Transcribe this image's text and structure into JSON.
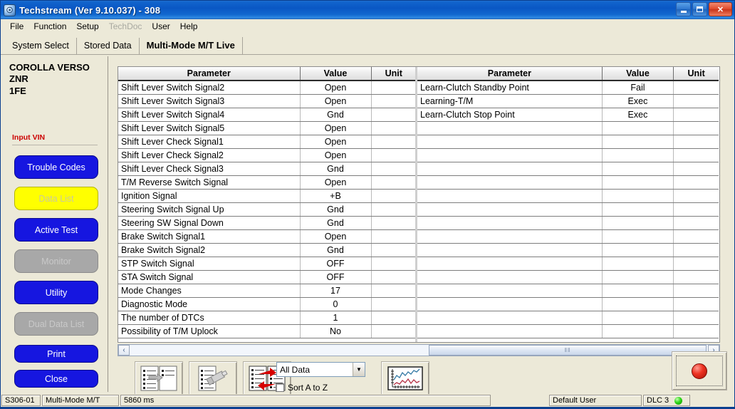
{
  "titlebar": {
    "title": "Techstream (Ver 9.10.037) - 308",
    "icon": "techstream-logo-icon",
    "minimize": "–",
    "maximize": "❐",
    "close": "✕"
  },
  "menubar": {
    "items": [
      {
        "label": "File",
        "disabled": false
      },
      {
        "label": "Function",
        "disabled": false
      },
      {
        "label": "Setup",
        "disabled": false
      },
      {
        "label": "TechDoc",
        "disabled": true
      },
      {
        "label": "User",
        "disabled": false
      },
      {
        "label": "Help",
        "disabled": false
      }
    ]
  },
  "tabs": [
    {
      "label": "System Select",
      "active": false
    },
    {
      "label": "Stored Data",
      "active": false
    },
    {
      "label": "Multi-Mode M/T Live",
      "active": true
    }
  ],
  "sidebar": {
    "vehicle": {
      "model": "COROLLA VERSO",
      "code": "ZNR",
      "engine": "1FE"
    },
    "vin_label": "Input VIN",
    "vin_label_color": "#cc0000",
    "buttons": [
      {
        "label": "Trouble Codes",
        "style": "blue"
      },
      {
        "label": "Data List",
        "style": "yellow"
      },
      {
        "label": "Active Test",
        "style": "blue"
      },
      {
        "label": "Monitor",
        "style": "gray"
      },
      {
        "label": "Utility",
        "style": "blue"
      },
      {
        "label": "Dual Data List",
        "style": "gray"
      },
      {
        "label": "Print",
        "style": "blue"
      },
      {
        "label": "Close",
        "style": "blue"
      }
    ]
  },
  "grid": {
    "headers": {
      "parameter": "Parameter",
      "value": "Value",
      "unit": "Unit"
    },
    "left_rows": [
      {
        "parameter": "Shift Lever Switch Signal2",
        "value": "Open",
        "unit": ""
      },
      {
        "parameter": "Shift Lever Switch Signal3",
        "value": "Open",
        "unit": ""
      },
      {
        "parameter": "Shift Lever Switch Signal4",
        "value": "Gnd",
        "unit": ""
      },
      {
        "parameter": "Shift Lever Switch Signal5",
        "value": "Open",
        "unit": ""
      },
      {
        "parameter": "Shift Lever Check Signal1",
        "value": "Open",
        "unit": ""
      },
      {
        "parameter": "Shift Lever Check Signal2",
        "value": "Open",
        "unit": ""
      },
      {
        "parameter": "Shift Lever Check Signal3",
        "value": "Gnd",
        "unit": ""
      },
      {
        "parameter": "T/M Reverse Switch Signal",
        "value": "Open",
        "unit": ""
      },
      {
        "parameter": "Ignition Signal",
        "value": "+B",
        "unit": ""
      },
      {
        "parameter": "Steering Switch Signal Up",
        "value": "Gnd",
        "unit": ""
      },
      {
        "parameter": "Steering SW Signal Down",
        "value": "Gnd",
        "unit": ""
      },
      {
        "parameter": "Brake Switch Signal1",
        "value": "Open",
        "unit": ""
      },
      {
        "parameter": "Brake Switch Signal2",
        "value": "Gnd",
        "unit": ""
      },
      {
        "parameter": "STP Switch Signal",
        "value": "OFF",
        "unit": ""
      },
      {
        "parameter": "STA Switch Signal",
        "value": "OFF",
        "unit": ""
      },
      {
        "parameter": "Mode Changes",
        "value": "17",
        "unit": ""
      },
      {
        "parameter": "Diagnostic Mode",
        "value": "0",
        "unit": ""
      },
      {
        "parameter": "The number of DTCs",
        "value": "1",
        "unit": ""
      },
      {
        "parameter": "Possibility of T/M Uplock",
        "value": "No",
        "unit": ""
      }
    ],
    "right_rows": [
      {
        "parameter": "Learn-Clutch Standby Point",
        "value": "Fail",
        "unit": ""
      },
      {
        "parameter": "Learning-T/M",
        "value": "Exec",
        "unit": ""
      },
      {
        "parameter": "Learn-Clutch Stop Point",
        "value": "Exec",
        "unit": ""
      },
      {
        "parameter": "",
        "value": "",
        "unit": ""
      },
      {
        "parameter": "",
        "value": "",
        "unit": ""
      },
      {
        "parameter": "",
        "value": "",
        "unit": ""
      },
      {
        "parameter": "",
        "value": "",
        "unit": ""
      },
      {
        "parameter": "",
        "value": "",
        "unit": ""
      },
      {
        "parameter": "",
        "value": "",
        "unit": ""
      },
      {
        "parameter": "",
        "value": "",
        "unit": ""
      },
      {
        "parameter": "",
        "value": "",
        "unit": ""
      },
      {
        "parameter": "",
        "value": "",
        "unit": ""
      },
      {
        "parameter": "",
        "value": "",
        "unit": ""
      },
      {
        "parameter": "",
        "value": "",
        "unit": ""
      },
      {
        "parameter": "",
        "value": "",
        "unit": ""
      },
      {
        "parameter": "",
        "value": "",
        "unit": ""
      },
      {
        "parameter": "",
        "value": "",
        "unit": ""
      },
      {
        "parameter": "",
        "value": "",
        "unit": ""
      },
      {
        "parameter": "",
        "value": "",
        "unit": ""
      }
    ]
  },
  "scrollbar": {
    "left_arrow": "‹",
    "right_arrow": "›",
    "grip": "‖‖"
  },
  "toolbar": {
    "buttons": [
      {
        "name": "compare-data-list-icon"
      },
      {
        "name": "save-snapshot-icon"
      },
      {
        "name": "refresh-data-list-icon"
      },
      {
        "name": "graph-view-icon"
      }
    ],
    "filter": {
      "selected": "All Data",
      "arrow": "▼"
    },
    "sort_checkbox": {
      "label": "Sort A to Z",
      "checked": false
    },
    "record_button": "record-button"
  },
  "statusbar": {
    "system_code": "S306-01",
    "system_name": "Multi-Mode M/T",
    "refresh_rate": "5860 ms",
    "user": "Default User",
    "connection": "DLC 3",
    "connection_ok_color": "#2fd61a"
  }
}
